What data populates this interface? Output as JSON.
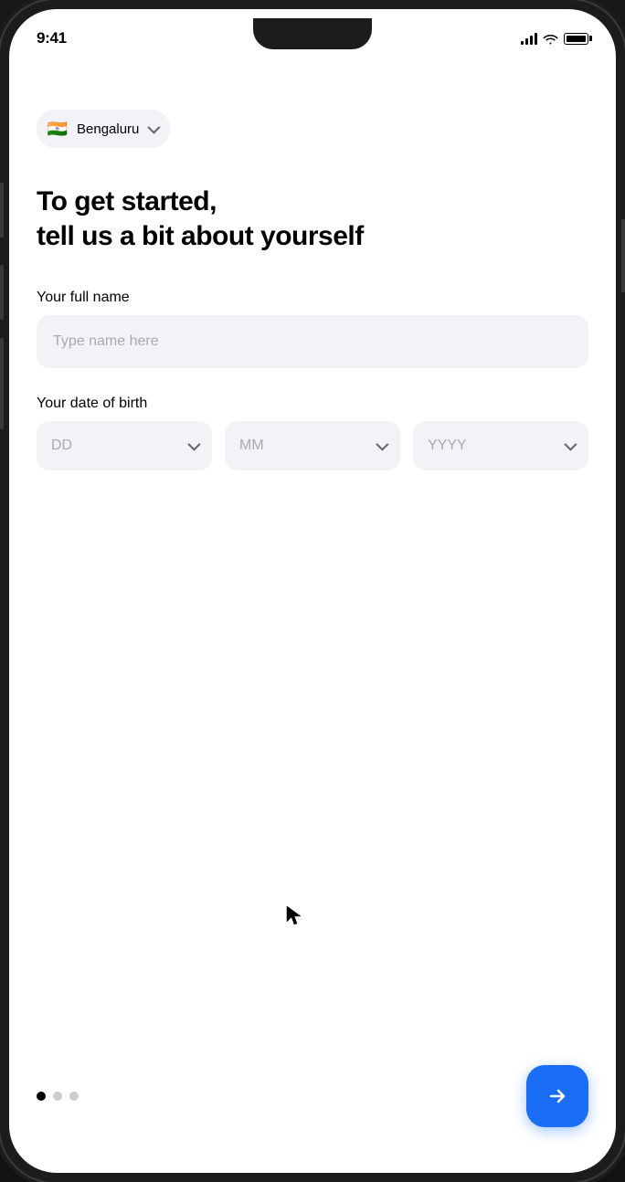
{
  "statusBar": {
    "time": "9:41",
    "timeLabel": "current-time"
  },
  "locationPill": {
    "flag": "🇮🇳",
    "city": "Bengaluru",
    "chevronLabel": "chevron-down"
  },
  "headline": {
    "line1": "To get started,",
    "line2": "tell us a bit about yourself"
  },
  "fullNameSection": {
    "label": "Your full name",
    "placeholder": "Type name here"
  },
  "dateOfBirthSection": {
    "label": "Your date of birth",
    "dayPlaceholder": "DD",
    "monthPlaceholder": "MM",
    "yearPlaceholder": "YYYY"
  },
  "pagination": {
    "dots": [
      {
        "active": true
      },
      {
        "active": false
      },
      {
        "active": false
      }
    ]
  },
  "nextButton": {
    "label": "Next"
  }
}
